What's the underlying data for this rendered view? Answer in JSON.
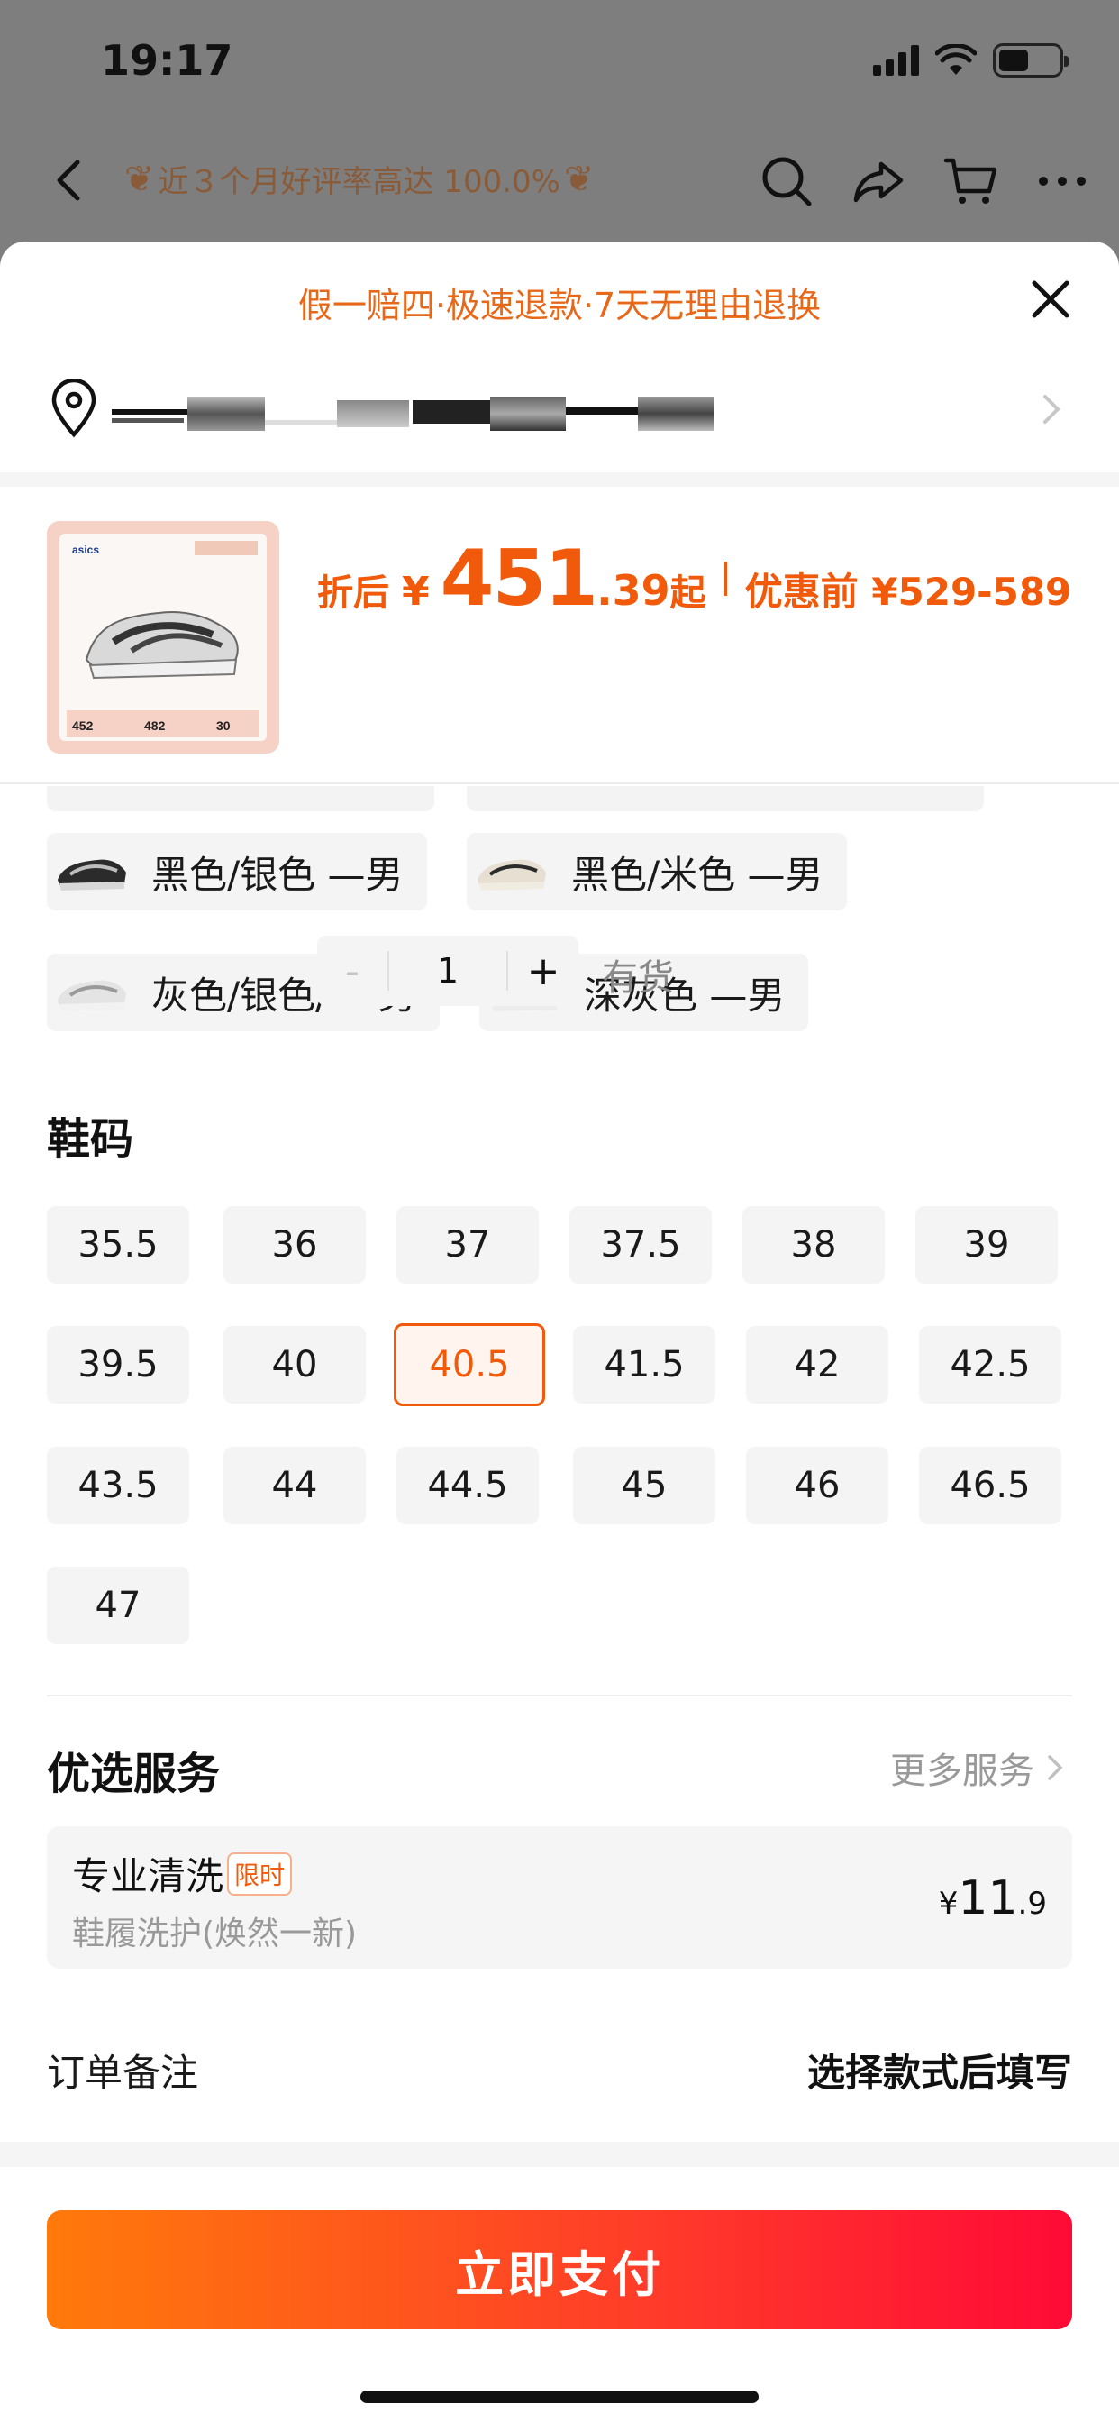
{
  "status_bar": {
    "time": "19:17"
  },
  "nav": {
    "rating_text": "近３个月好评率高达 100.0%"
  },
  "sheet": {
    "promo_text": "假一赔四·极速退款·7天无理由退换",
    "product": {
      "price_label": "折后",
      "currency": "¥",
      "price_int": "451",
      "price_dec": ".39",
      "price_suffix": "起",
      "before_label": "优惠前 ¥529-589",
      "quantity": "1",
      "minus": "-",
      "plus": "+",
      "stock": "有货"
    },
    "colors": [
      {
        "label": "黑色/银色 —男",
        "icon": "black-silver-shoe"
      },
      {
        "label": "黑色/米色 —男",
        "icon": "black-beige-shoe"
      },
      {
        "label": "灰色/银色/ —男",
        "icon": "grey-silver-shoe"
      },
      {
        "label": "深灰色 —男",
        "icon": "dark-grey-shoe"
      }
    ],
    "size_title": "鞋码",
    "sizes": [
      "35.5",
      "36",
      "37",
      "37.5",
      "38",
      "39",
      "39.5",
      "40",
      "40.5",
      "41.5",
      "42",
      "42.5",
      "43.5",
      "44",
      "44.5",
      "45",
      "46",
      "46.5",
      "47"
    ],
    "selected_size": "40.5",
    "services": {
      "title": "优选服务",
      "more": "更多服务",
      "card": {
        "name": "专业清洗",
        "badge": "限时",
        "desc": "鞋履洗护(焕然一新)",
        "price_yen": "¥",
        "price_int": "11",
        "price_dec": ".9"
      }
    },
    "order_note": {
      "label": "订单备注",
      "value": "选择款式后填写"
    },
    "pay_button": "立即支付"
  },
  "colors": {
    "accent": "#f05a0a",
    "promo": "#e8681a"
  }
}
